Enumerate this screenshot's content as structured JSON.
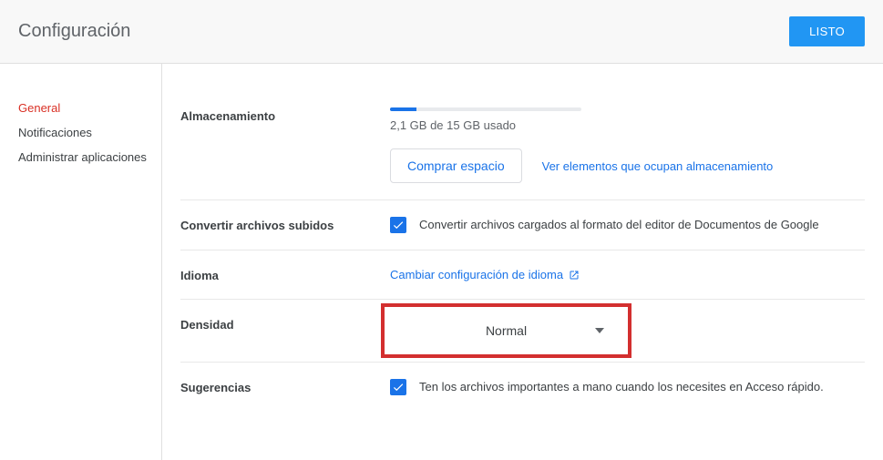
{
  "header": {
    "title": "Configuración",
    "done_label": "LISTO"
  },
  "sidebar": {
    "items": [
      {
        "label": "General",
        "active": true
      },
      {
        "label": "Notificaciones",
        "active": false
      },
      {
        "label": "Administrar aplicaciones",
        "active": false
      }
    ]
  },
  "storage": {
    "section_label": "Almacenamiento",
    "usage_text": "2,1 GB de 15 GB usado",
    "progress_percent": 14,
    "buy_label": "Comprar espacio",
    "view_link": "Ver elementos que ocupan almacenamiento"
  },
  "convert": {
    "section_label": "Convertir archivos subidos",
    "checkbox_checked": true,
    "checkbox_label": "Convertir archivos cargados al formato del editor de Documentos de Google"
  },
  "language": {
    "section_label": "Idioma",
    "link_label": "Cambiar configuración de idioma"
  },
  "density": {
    "section_label": "Densidad",
    "selected": "Normal"
  },
  "suggestions": {
    "section_label": "Sugerencias",
    "checkbox_checked": true,
    "checkbox_label": "Ten los archivos importantes a mano cuando los necesites en Acceso rápido."
  }
}
